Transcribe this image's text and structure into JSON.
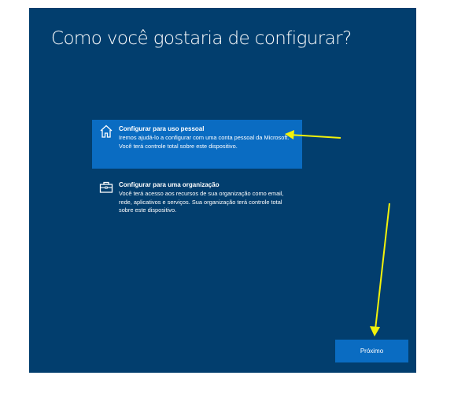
{
  "page": {
    "title": "Como você gostaria de configurar?"
  },
  "options": [
    {
      "title": "Configurar para uso pessoal",
      "description": "Iremos ajudá-lo a configurar com uma conta pessoal da Microsoft. Você terá controle total sobre este dispositivo.",
      "icon": "home-icon",
      "selected": true
    },
    {
      "title": "Configurar para uma organização",
      "description": "Você terá acesso aos recursos de sua organização como email, rede, aplicativos e serviços. Sua organização terá controle total sobre este dispositivo.",
      "icon": "briefcase-icon",
      "selected": false
    }
  ],
  "footer": {
    "next_label": "Próximo"
  },
  "colors": {
    "background": "#023e6e",
    "accent": "#0a6cc2",
    "annotation_arrow": "#f2f20a",
    "text": "#ffffff"
  }
}
